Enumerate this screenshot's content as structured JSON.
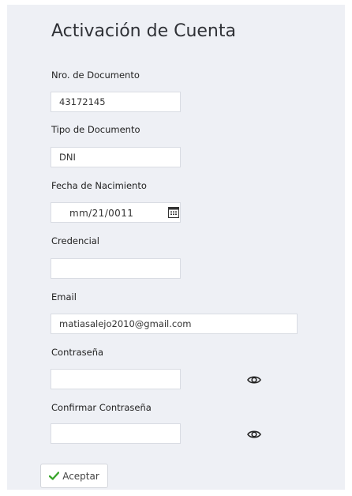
{
  "form": {
    "title": "Activación de Cuenta",
    "documento": {
      "label": "Nro. de Documento",
      "value": "43172145"
    },
    "tipo": {
      "label": "Tipo de Documento",
      "value": "DNI"
    },
    "fecha": {
      "label": "Fecha de Nacimiento",
      "value": "mm/21/0011"
    },
    "credencial": {
      "label": "Credencial",
      "value": ""
    },
    "email": {
      "label": "Email",
      "value": "matiasalejo2010@gmail.com"
    },
    "password": {
      "label": "Contraseña",
      "value": ""
    },
    "confirm": {
      "label": "Confirmar Contraseña",
      "value": ""
    },
    "submit_label": "Aceptar"
  },
  "icons": {
    "calendar": "calendar-icon",
    "eye": "eye-icon",
    "check": "check-icon"
  },
  "colors": {
    "panel_bg": "#eef0f5",
    "check_green": "#3aa52b"
  }
}
